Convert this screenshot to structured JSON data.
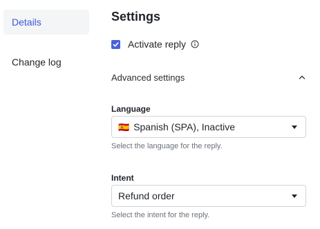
{
  "sidebar": {
    "items": [
      {
        "label": "Details",
        "active": true
      },
      {
        "label": "Change log",
        "active": false
      }
    ]
  },
  "main": {
    "title": "Settings",
    "activate_reply": {
      "label": "Activate reply",
      "checked": true
    },
    "advanced": {
      "label": "Advanced settings",
      "expanded": true
    },
    "language": {
      "label": "Language",
      "flag_icon": "spain-flag-icon",
      "flag_glyph": "🇪🇸",
      "value": "Spanish (SPA), Inactive",
      "help": "Select the language for the reply."
    },
    "intent": {
      "label": "Intent",
      "value": "Refund order",
      "help": "Select the intent for the reply."
    }
  },
  "colors": {
    "accent": "#3b57d9",
    "checkbox": "#4a62d8",
    "nav_active_bg": "#f4f5f6",
    "border": "#d0d4d9",
    "help_text": "#6a7078"
  }
}
